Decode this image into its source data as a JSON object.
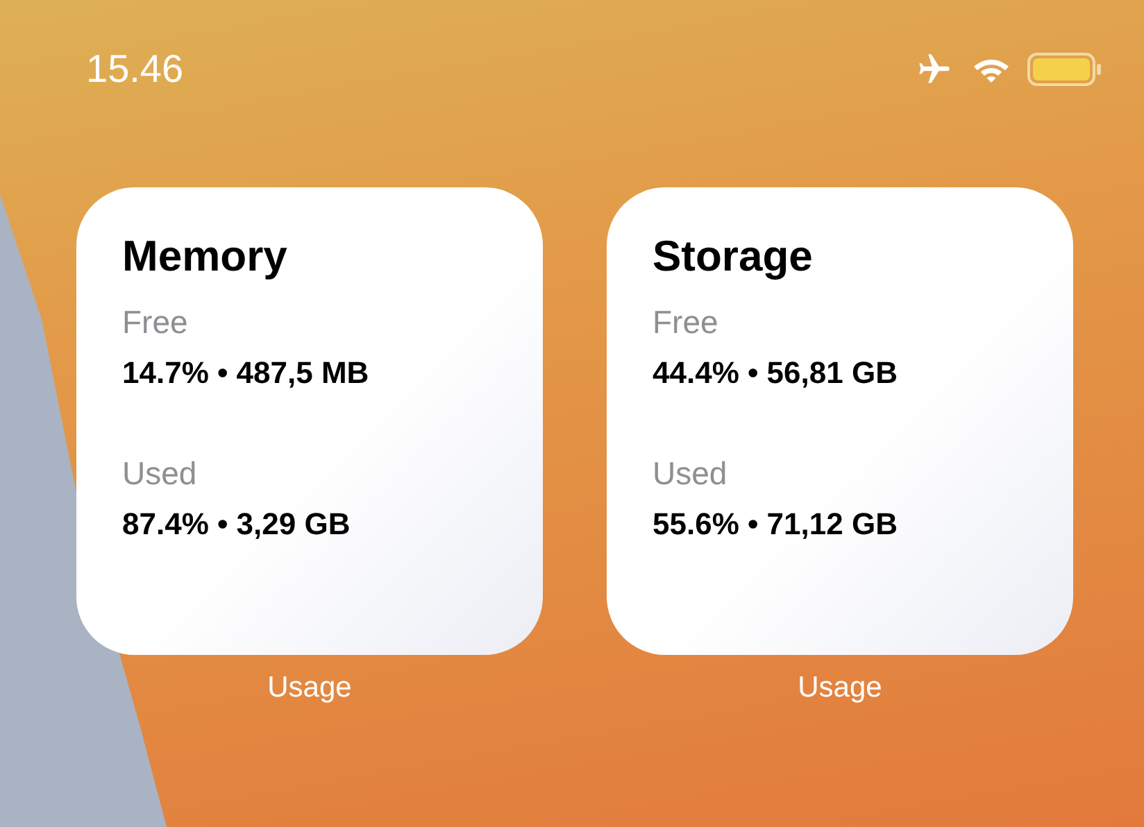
{
  "status_bar": {
    "time": "15.46"
  },
  "widgets": [
    {
      "title": "Memory",
      "stats": [
        {
          "label": "Free",
          "value": "14.7% • 487,5 MB"
        },
        {
          "label": "Used",
          "value": "87.4% • 3,29 GB"
        }
      ],
      "caption": "Usage"
    },
    {
      "title": "Storage",
      "stats": [
        {
          "label": "Free",
          "value": "44.4% • 56,81 GB"
        },
        {
          "label": "Used",
          "value": "55.6% • 71,12 GB"
        }
      ],
      "caption": "Usage"
    }
  ]
}
